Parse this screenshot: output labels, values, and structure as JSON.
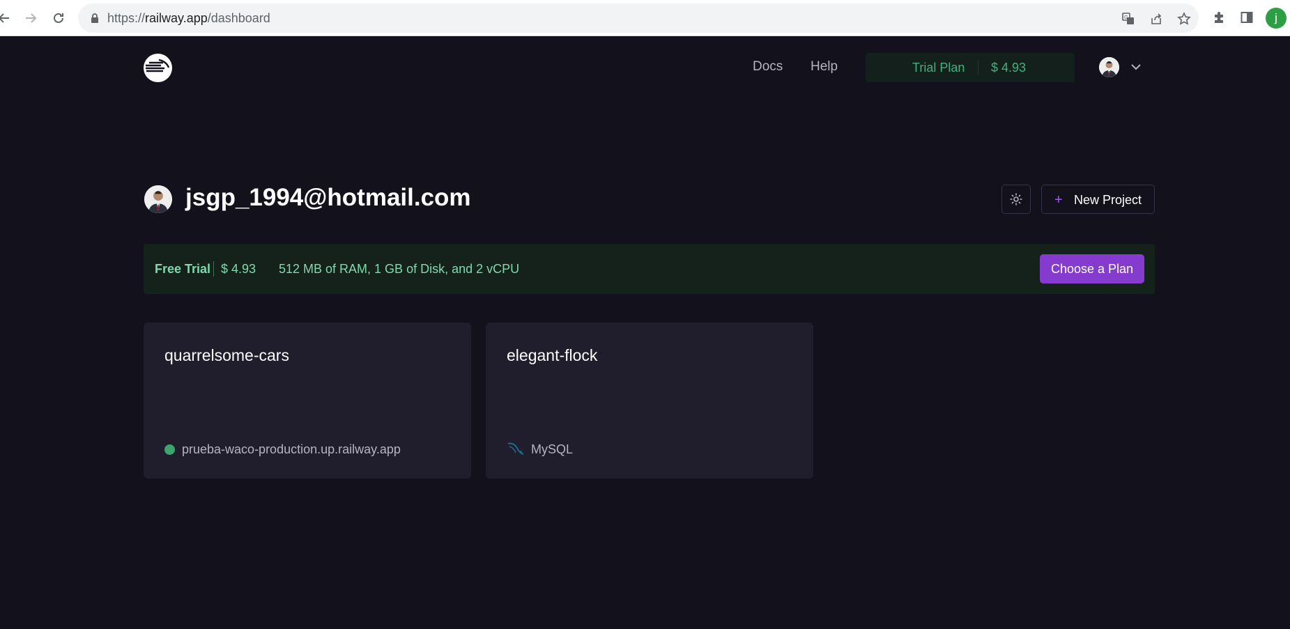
{
  "browser": {
    "url_scheme": "https://",
    "url_host": "railway.app",
    "url_path": "/dashboard",
    "profile_initial": "j",
    "icons": [
      "back-icon",
      "forward-icon",
      "reload-icon",
      "lock-icon",
      "translate-icon",
      "share-icon",
      "bookmark-star-icon",
      "extensions-icon",
      "side-panel-icon"
    ]
  },
  "header": {
    "docs_label": "Docs",
    "help_label": "Help",
    "plan_name": "Trial Plan",
    "plan_amount": "$ 4.93"
  },
  "workspace": {
    "title": "jsgp_1994@hotmail.com",
    "new_project_label": "New Project"
  },
  "banner": {
    "plan": "Free Trial",
    "amount": "$ 4.93",
    "resources": "512 MB of RAM, 1 GB of Disk, and 2 vCPU",
    "cta_label": "Choose a Plan"
  },
  "projects": [
    {
      "name": "quarrelsome-cars",
      "service": "prueba-waco-production.up.railway.app",
      "service_icon": "status-dot-icon"
    },
    {
      "name": "elegant-flock",
      "service": "MySQL",
      "service_icon": "mysql-icon"
    }
  ],
  "colors": {
    "background": "#13111c",
    "card": "#201e2c",
    "accent_purple": "#853bce",
    "trial_green": "#3fb27f",
    "banner_text": "#7fd9ad"
  }
}
